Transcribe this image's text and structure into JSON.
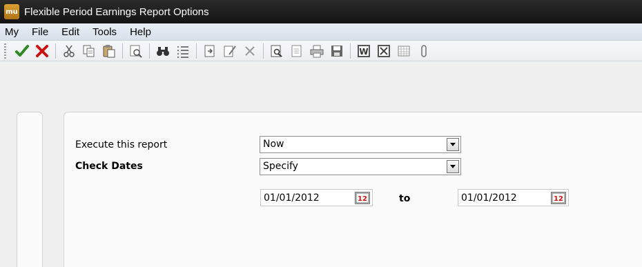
{
  "window": {
    "logo_text": "mu",
    "title": "Flexible Period Earnings Report Options"
  },
  "menu": {
    "items": [
      {
        "label": "My"
      },
      {
        "label": "File"
      },
      {
        "label": "Edit"
      },
      {
        "label": "Tools"
      },
      {
        "label": "Help"
      }
    ]
  },
  "toolbar": {
    "icons": [
      "ok-check-icon",
      "cancel-x-icon",
      "cut-icon",
      "copy-icon",
      "paste-icon",
      "find-record-icon",
      "binoculars-icon",
      "list-icon",
      "export-icon",
      "edit-icon",
      "delete-icon",
      "print-preview-icon",
      "document-icon",
      "printer-icon",
      "save-icon",
      "word-icon",
      "excel-icon",
      "grid-icon",
      "attachment-icon"
    ],
    "colors": {
      "ok": "#2c8a1f",
      "cancel": "#cc1010"
    }
  },
  "form": {
    "execute_label": "Execute this report",
    "execute_value": "Now",
    "check_dates_label": "Check Dates",
    "check_dates_value": "Specify",
    "date_from": "01/01/2012",
    "to_label": "to",
    "date_to": "01/01/2012"
  }
}
